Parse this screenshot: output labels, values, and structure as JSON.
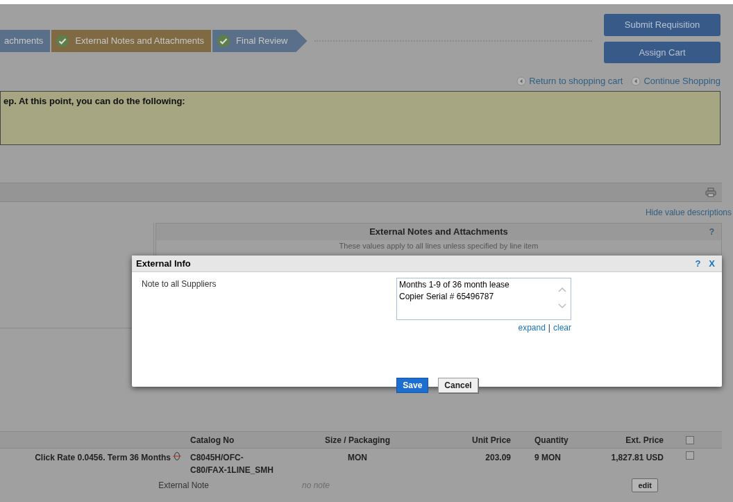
{
  "steps": [
    {
      "label": "achments",
      "current": false
    },
    {
      "label": "External Notes and Attachments",
      "completed": true,
      "current": true
    },
    {
      "label": "Final Review",
      "completed": true,
      "current": false
    }
  ],
  "actions": [
    "Submit Requisition",
    "Assign Cart"
  ],
  "nav_links": [
    "Return to shopping cart",
    "Continue Shopping"
  ],
  "notice": "ep. At this point, you can do the following:",
  "hide_link": "Hide value descriptions",
  "panel": {
    "title": "External Notes and Attachments",
    "help": "?",
    "subtitle": "These values apply to all lines unless specified by line item"
  },
  "dialog": {
    "title": "External Info",
    "help": "?",
    "close": "X",
    "field_label": "Note to all Suppliers",
    "field_value": "Months 1-9 of 36 month lease\nCopier Serial # 65496787",
    "links": [
      "expand",
      "clear"
    ],
    "separator": "|",
    "buttons": [
      "Save",
      "Cancel"
    ]
  },
  "table": {
    "columns": [
      "Catalog No",
      "Size / Packaging",
      "Unit Price",
      "Quantity",
      "Ext. Price"
    ],
    "header_checked": false,
    "rows": [
      {
        "description": "Click Rate 0.0456. Term 36 Months",
        "catalog_no": "C8045H/OFC-C80/FAX-1LINE_SMH",
        "size": "MON",
        "unit_price": "203.09",
        "quantity": "9 MON",
        "ext_price": "1,827.81 USD",
        "checked": false,
        "note_label": "External Note",
        "note": "no note",
        "note_button": "edit"
      }
    ]
  }
}
